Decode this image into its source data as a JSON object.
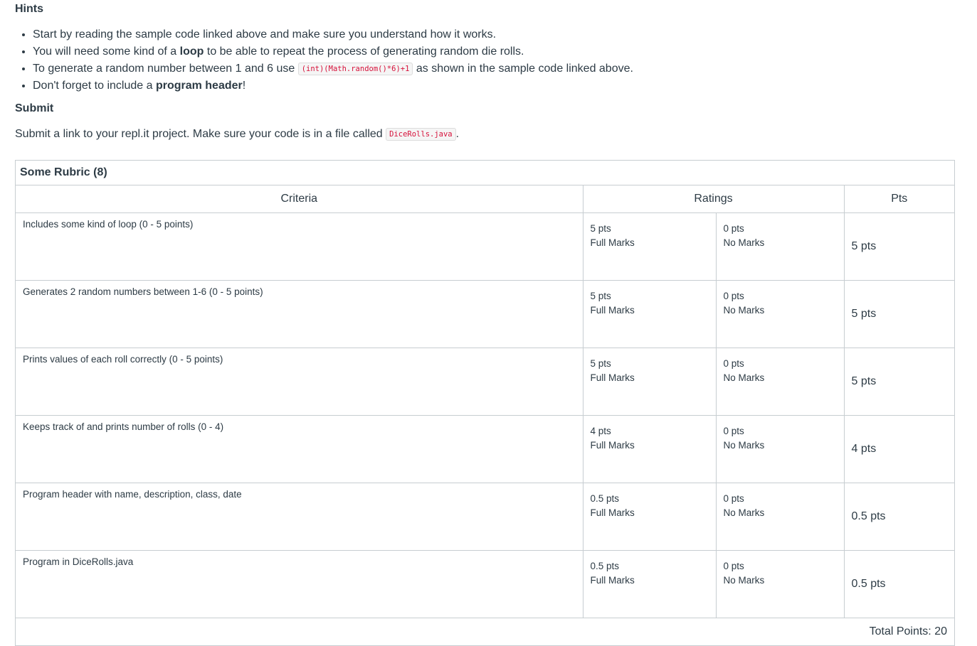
{
  "hints": {
    "title": "Hints",
    "items": [
      {
        "text_before": "Start by reading the sample code linked above and make sure you understand how it works.",
        "bold": "",
        "text_after": "",
        "code": ""
      },
      {
        "text_before": "You will need some kind of a ",
        "bold": "loop",
        "text_after": " to be able to repeat the process of generating random die rolls.",
        "code": ""
      },
      {
        "text_before": "To generate a random number between 1 and 6 use ",
        "code": "(int)(Math.random()*6)+1",
        "text_after": " as shown in the sample code linked above.",
        "bold": ""
      },
      {
        "text_before": "Don't forget to include a ",
        "bold": "program header",
        "text_after": "!",
        "code": ""
      }
    ]
  },
  "submit": {
    "title": "Submit",
    "text_before": "Submit a link to your repl.it project. Make sure your code is in a file called ",
    "code": "DiceRolls.java",
    "text_after": "."
  },
  "rubric": {
    "title": "Some Rubric (8)",
    "headers": {
      "criteria": "Criteria",
      "ratings": "Ratings",
      "pts": "Pts"
    },
    "rows": [
      {
        "criterion": "Includes some kind of loop (0 - 5 points)",
        "full_pts": "5 pts",
        "full_label": "Full Marks",
        "none_pts": "0 pts",
        "none_label": "No Marks",
        "pts": "5 pts"
      },
      {
        "criterion": "Generates 2 random numbers between 1-6 (0 - 5 points)",
        "full_pts": "5 pts",
        "full_label": "Full Marks",
        "none_pts": "0 pts",
        "none_label": "No Marks",
        "pts": "5 pts"
      },
      {
        "criterion": "Prints values of each roll correctly (0 - 5 points)",
        "full_pts": "5 pts",
        "full_label": "Full Marks",
        "none_pts": "0 pts",
        "none_label": "No Marks",
        "pts": "5 pts"
      },
      {
        "criterion": "Keeps track of and prints number of rolls (0 - 4)",
        "full_pts": "4 pts",
        "full_label": "Full Marks",
        "none_pts": "0 pts",
        "none_label": "No Marks",
        "pts": "4 pts"
      },
      {
        "criterion": "Program header with name, description, class, date",
        "full_pts": "0.5 pts",
        "full_label": "Full Marks",
        "none_pts": "0 pts",
        "none_label": "No Marks",
        "pts": "0.5 pts"
      },
      {
        "criterion": "Program in DiceRolls.java",
        "full_pts": "0.5 pts",
        "full_label": "Full Marks",
        "none_pts": "0 pts",
        "none_label": "No Marks",
        "pts": "0.5 pts"
      }
    ],
    "total": "Total Points: 20"
  }
}
